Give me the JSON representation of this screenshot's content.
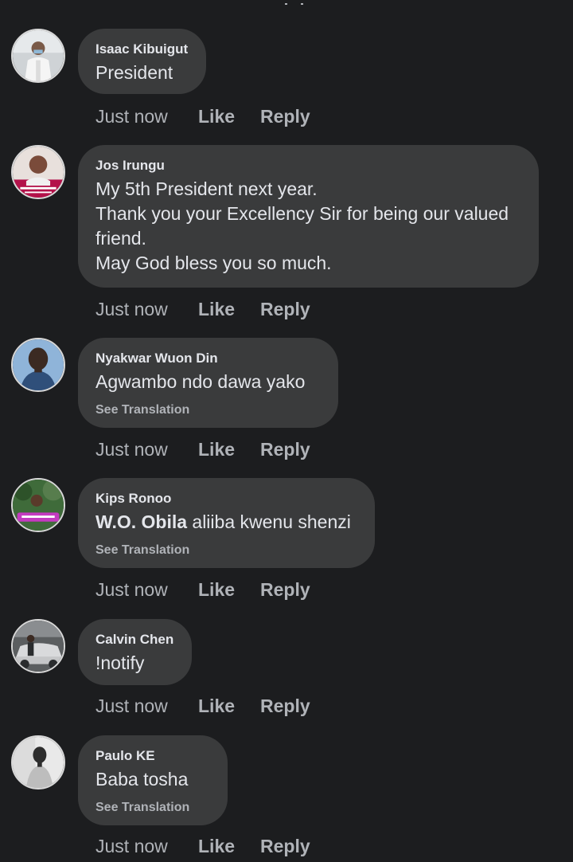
{
  "comments": [
    {
      "author": "Isaac Kibuigut",
      "lines": [
        "President"
      ],
      "time": "Just now",
      "like_label": "Like",
      "reply_label": "Reply",
      "avatar_colors": [
        "#cfd3d6",
        "#6b7e8a",
        "#f2f2f2"
      ]
    },
    {
      "author": "Jos Irungu",
      "lines": [
        "My 5th President next year.",
        "Thank you your Excellency Sir for being our valued",
        "friend.",
        "May God bless you so much."
      ],
      "time": "Just now",
      "like_label": "Like",
      "reply_label": "Reply",
      "avatar_colors": [
        "#e8e0dc",
        "#7a4b3a",
        "#b3124a"
      ]
    },
    {
      "author": "Nyakwar Wuon Din",
      "lines": [
        "Agwambo ndo dawa yako"
      ],
      "see_translation": "See Translation",
      "time": "Just now",
      "like_label": "Like",
      "reply_label": "Reply",
      "avatar_colors": [
        "#8fb4d9",
        "#3b2a22",
        "#2f4f7a"
      ]
    },
    {
      "author": "Kips Ronoo",
      "mention": "W.O. Obila",
      "rest": " aliiba kwenu shenzi",
      "see_translation": "See Translation",
      "time": "Just now",
      "like_label": "Like",
      "reply_label": "Reply",
      "avatar_colors": [
        "#3f6b3a",
        "#c43bc0",
        "#5a3a2a"
      ]
    },
    {
      "author": "Calvin Chen",
      "lines": [
        "!notify"
      ],
      "time": "Just now",
      "like_label": "Like",
      "reply_label": "Reply",
      "avatar_colors": [
        "#5b5e60",
        "#d9dadc",
        "#2a2c2e"
      ]
    },
    {
      "author": "Paulo KE",
      "lines": [
        "Baba tosha"
      ],
      "see_translation": "See Translation",
      "time": "Just now",
      "like_label": "Like",
      "reply_label": "Reply",
      "avatar_colors": [
        "#e9e9e9",
        "#2d2d2d",
        "#bdbdbd"
      ]
    }
  ]
}
